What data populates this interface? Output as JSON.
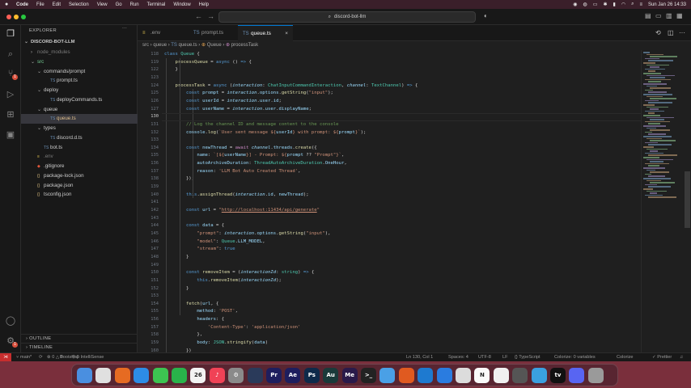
{
  "menubar": {
    "app": "Code",
    "items": [
      "File",
      "Edit",
      "Selection",
      "View",
      "Go",
      "Run",
      "Terminal",
      "Window",
      "Help"
    ],
    "datetime": "Sun Jan 26  14:33"
  },
  "titlebar": {
    "command_center": "discord-bot-llm"
  },
  "explorer": {
    "title": "EXPLORER",
    "root": "DISCORD-BOT-LLM",
    "tree": [
      {
        "label": "node_modules",
        "kind": "folder",
        "depth": 1,
        "open": false,
        "dim": true
      },
      {
        "label": "src",
        "kind": "folder",
        "depth": 1,
        "open": true,
        "color": "#73c991"
      },
      {
        "label": "commands/prompt",
        "kind": "folder",
        "depth": 2,
        "open": true
      },
      {
        "label": "prompt.ts",
        "kind": "ts",
        "depth": 3
      },
      {
        "label": "deploy",
        "kind": "folder",
        "depth": 2,
        "open": true
      },
      {
        "label": "deployCommands.ts",
        "kind": "ts",
        "depth": 3
      },
      {
        "label": "queue",
        "kind": "folder",
        "depth": 2,
        "open": true
      },
      {
        "label": "queue.ts",
        "kind": "ts",
        "depth": 3,
        "selected": true,
        "color": "#e2c08d"
      },
      {
        "label": "types",
        "kind": "folder",
        "depth": 2,
        "open": true
      },
      {
        "label": "discord.d.ts",
        "kind": "ts",
        "depth": 3
      },
      {
        "label": "bot.ts",
        "kind": "ts",
        "depth": 2
      },
      {
        "label": ".env",
        "kind": "env",
        "depth": 1,
        "dim": true
      },
      {
        "label": ".gitignore",
        "kind": "git",
        "depth": 1
      },
      {
        "label": "package-lock.json",
        "kind": "json",
        "depth": 1
      },
      {
        "label": "package.json",
        "kind": "json",
        "depth": 1
      },
      {
        "label": "tsconfig.json",
        "kind": "json",
        "depth": 1
      }
    ],
    "outline": "OUTLINE",
    "timeline": "TIMELINE"
  },
  "tabs": [
    {
      "label": ".env",
      "icon": "env-file-icon",
      "active": false
    },
    {
      "label": "prompt.ts",
      "icon": "ts-file-icon",
      "active": false
    },
    {
      "label": "queue.ts",
      "icon": "ts-file-icon",
      "active": true
    }
  ],
  "breadcrumbs": [
    "src",
    "queue",
    "queue.ts",
    "Queue",
    "processTask"
  ],
  "editor": {
    "current_line": 130,
    "lines": [
      {
        "n": "118",
        "html": "<span class='k'>class</span> <span class='t'>Queue</span> {"
      },
      {
        "n": "119",
        "html": "    <span class='f'>processQueue</span> = <span class='k'>async</span> () <span class='k'>=&gt;</span> {"
      },
      {
        "n": "122",
        "html": "    }"
      },
      {
        "n": "123",
        "html": ""
      },
      {
        "n": "124",
        "html": "    <span class='f'>processTask</span> = <span class='k'>async</span> (<span class='pm'>interaction</span>: <span class='t'>ChatInputCommandInteraction</span>, <span class='pm'>channel</span>: <span class='t'>TextChannel</span>) <span class='k'>=&gt;</span> {"
      },
      {
        "n": "125",
        "html": "        <span class='k'>const</span> <span class='v'>prompt</span> = <span class='pm'>interaction</span>.<span class='v'>options</span>.<span class='f'>getString</span>(<span class='s'>\"input\"</span>);"
      },
      {
        "n": "126",
        "html": "        <span class='k'>const</span> <span class='v'>userId</span> = <span class='pm'>interaction</span>.<span class='v'>user</span>.<span class='v'>id</span>;"
      },
      {
        "n": "127",
        "html": "        <span class='k'>const</span> <span class='v'>userName</span> = <span class='pm'>interaction</span>.<span class='v'>user</span>.<span class='v'>displayName</span>;"
      },
      {
        "n": "130",
        "html": ""
      },
      {
        "n": "131",
        "html": "        <span class='c'>// Log the channel ID and message content to the console</span>"
      },
      {
        "n": "132",
        "html": "        <span class='v'>console</span>.<span class='f'>log</span>(<span class='s'>`User sent message ${</span><span class='v'>userId</span><span class='s'>} with prompt: ${</span><span class='v'>prompt</span><span class='s'>}`</span>);"
      },
      {
        "n": "133",
        "html": ""
      },
      {
        "n": "134",
        "html": "        <span class='k'>const</span> <span class='v'>newThread</span> = <span class='kw'>await</span> <span class='pm'>channel</span>.<span class='v'>threads</span>.<span class='f'>create</span>({"
      },
      {
        "n": "135",
        "html": "            <span class='v'>name</span>: <span class='s'>`[${</span><span class='v'>userName</span><span class='s'>}] - Prompt: ${</span><span class='v'>prompt</span> ?? <span class='s'>\"Prompt\"</span><span class='s'>}`</span>,"
      },
      {
        "n": "136",
        "html": "            <span class='v'>autoArchiveDuration</span>: <span class='t'>ThreadAutoArchiveDuration</span>.<span class='v'>OneHour</span>,"
      },
      {
        "n": "137",
        "html": "            <span class='v'>reason</span>: <span class='s'>'LLM Bot Auto Created Thread'</span>,"
      },
      {
        "n": "138",
        "html": "        });"
      },
      {
        "n": "139",
        "html": ""
      },
      {
        "n": "140",
        "html": "        <span class='k'>this</span>.<span class='f'>assignThread</span>(<span class='pm'>interaction</span>.<span class='v'>id</span>, <span class='v'>newThread</span>);"
      },
      {
        "n": "141",
        "html": ""
      },
      {
        "n": "142",
        "html": "        <span class='k'>const</span> <span class='v'>url</span> = <span class='s'>\"</span><span class='lnk'>http://localhost:11434/api/generate</span><span class='s'>\"</span>"
      },
      {
        "n": "143",
        "html": ""
      },
      {
        "n": "144",
        "html": "        <span class='k'>const</span> <span class='v'>data</span> = {"
      },
      {
        "n": "145",
        "html": "            <span class='s'>\"prompt\"</span>: <span class='pm'>interaction</span>.<span class='v'>options</span>.<span class='f'>getString</span>(<span class='s'>\"input\"</span>),"
      },
      {
        "n": "146",
        "html": "            <span class='s'>\"model\"</span>: <span class='t'>Queue</span>.<span class='v'>LLM_MODEL</span>,"
      },
      {
        "n": "147",
        "html": "            <span class='s'>\"stream\"</span>: <span class='k'>true</span>"
      },
      {
        "n": "148",
        "html": "        }"
      },
      {
        "n": "149",
        "html": ""
      },
      {
        "n": "150",
        "html": "        <span class='k'>const</span> <span class='f'>removeItem</span> = (<span class='pm'>interactionId</span>: <span class='t'>string</span>) <span class='k'>=&gt;</span> {"
      },
      {
        "n": "151",
        "html": "            <span class='k'>this</span>.<span class='f'>removeItem</span>(<span class='pm'>interactionId</span>);"
      },
      {
        "n": "152",
        "html": "        }"
      },
      {
        "n": "153",
        "html": ""
      },
      {
        "n": "154",
        "html": "        <span class='f'>fetch</span>(<span class='v'>url</span>, {"
      },
      {
        "n": "155",
        "html": "            <span class='v'>method</span>: <span class='s'>'POST'</span>,"
      },
      {
        "n": "156",
        "html": "            <span class='v'>headers</span>: {"
      },
      {
        "n": "157",
        "html": "                <span class='s'>'Content-Type'</span>: <span class='s'>'application/json'</span>"
      },
      {
        "n": "158",
        "html": "            },"
      },
      {
        "n": "159",
        "html": "            <span class='v'>body</span>: <span class='t'>JSON</span>.<span class='f'>stringify</span>(<span class='v'>data</span>)"
      },
      {
        "n": "160",
        "html": "        })"
      }
    ]
  },
  "status": {
    "branch": "main*",
    "sync": "⟳",
    "errors": "⊗ 0 △ 0",
    "ports": "⚲ 0",
    "extension": "Bootstrap IntelliSense",
    "position": "Ln 130, Col 1",
    "spaces": "Spaces: 4",
    "encoding": "UTF-8",
    "eol": "LF",
    "language": "{} TypeScript",
    "colorize": "Colorize: 0 variables",
    "colorize2": "Colorize",
    "prettier": "✓ Prettier"
  },
  "dock": [
    {
      "name": "finder-icon",
      "label": "",
      "bg": "#4a8fe0"
    },
    {
      "name": "chrome-icon",
      "label": "",
      "bg": "#e0e0e0"
    },
    {
      "name": "firefox-icon",
      "label": "",
      "bg": "#e66b22"
    },
    {
      "name": "safari-icon",
      "label": "",
      "bg": "#2d8ce6"
    },
    {
      "name": "messages-icon",
      "label": "",
      "bg": "#3dc451"
    },
    {
      "name": "facetime-icon",
      "label": "",
      "bg": "#29b34a"
    },
    {
      "name": "calendar-icon",
      "label": "26",
      "bg": "#f2f2f2"
    },
    {
      "name": "music-icon",
      "label": "♪",
      "bg": "#f04256"
    },
    {
      "name": "settings-icon",
      "label": "⚙",
      "bg": "#8a8a8a"
    },
    {
      "name": "davinci-icon",
      "label": "",
      "bg": "#2a3a5a"
    },
    {
      "name": "premiere-icon",
      "label": "Pr",
      "bg": "#1e1e5e"
    },
    {
      "name": "aftereffects-icon",
      "label": "Ae",
      "bg": "#1e1e5e"
    },
    {
      "name": "photoshop-icon",
      "label": "Ps",
      "bg": "#0e2a4a"
    },
    {
      "name": "audition-icon",
      "label": "Au",
      "bg": "#1a3a3a"
    },
    {
      "name": "media-encoder-icon",
      "label": "Me",
      "bg": "#2a1a4a"
    },
    {
      "name": "terminal-icon",
      "label": ">_",
      "bg": "#222"
    },
    {
      "name": "files-icon",
      "label": "",
      "bg": "#4aa0e6"
    },
    {
      "name": "ubuntu-icon",
      "label": "",
      "bg": "#e05a20"
    },
    {
      "name": "vscode-icon",
      "label": "",
      "bg": "#1e7ad0"
    },
    {
      "name": "xcode-icon",
      "label": "",
      "bg": "#2a7ce0"
    },
    {
      "name": "simulator-icon",
      "label": "",
      "bg": "#dcdcdc"
    },
    {
      "name": "notion-icon",
      "label": "N",
      "bg": "#fafafa"
    },
    {
      "name": "textedit-icon",
      "label": "",
      "bg": "#f0f0f0"
    },
    {
      "name": "calculator-icon",
      "label": "",
      "bg": "#555"
    },
    {
      "name": "proxyman-icon",
      "label": "",
      "bg": "#3aa0e0"
    },
    {
      "name": "appletv-icon",
      "label": "tv",
      "bg": "#111"
    },
    {
      "name": "discord-icon",
      "label": "",
      "bg": "#5865f2"
    },
    {
      "name": "trash-icon",
      "label": "",
      "bg": "#9a9a9a"
    }
  ]
}
